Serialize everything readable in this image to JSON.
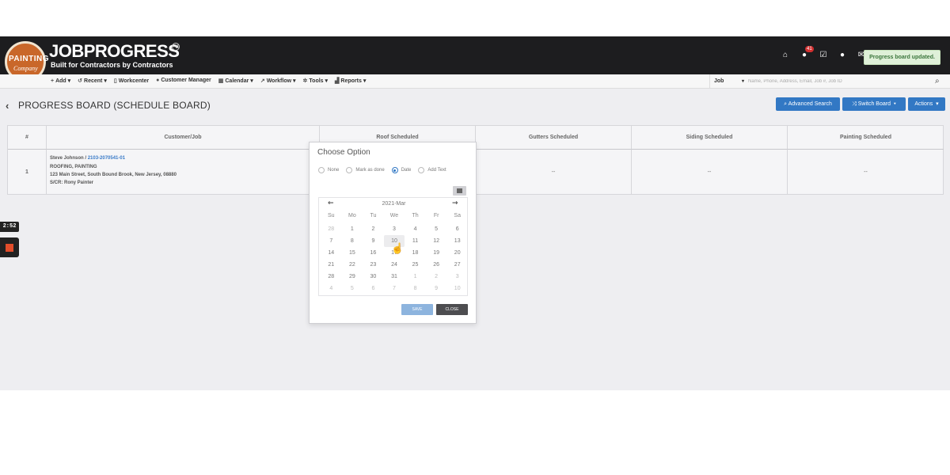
{
  "header": {
    "logo_text": "PAINTING",
    "logo_sub": "Company",
    "brand": "JOBPROGRESS",
    "trademark": "TM",
    "tagline": "Built for Contractors by Contractors",
    "notification_count": "41",
    "icons": [
      "home-icon",
      "bell-icon",
      "checkbox-icon",
      "chat-icon",
      "mail-icon"
    ],
    "toast": "Progress board updated."
  },
  "nav": {
    "items": [
      {
        "label": "Add",
        "icon": "plus-icon",
        "caret": true
      },
      {
        "label": "Recent",
        "icon": "history-icon",
        "caret": true
      },
      {
        "label": "Workcenter",
        "icon": "document-icon",
        "caret": false
      },
      {
        "label": "Customer Manager",
        "icon": "users-icon",
        "caret": false
      },
      {
        "label": "Calendar",
        "icon": "calendar-icon",
        "caret": true
      },
      {
        "label": "Workflow",
        "icon": "workflow-icon",
        "caret": true
      },
      {
        "label": "Tools",
        "icon": "gear-icon",
        "caret": true
      },
      {
        "label": "Reports",
        "icon": "chart-icon",
        "caret": true
      }
    ],
    "search_type": "Job",
    "search_placeholder": "Name, Phone, Address, Email, Job #, Job ID"
  },
  "page": {
    "title": "PROGRESS BOARD (SCHEDULE BOARD)",
    "buttons": {
      "advanced_search": "Advanced Search",
      "switch_board": "Switch Board",
      "actions": "Actions"
    }
  },
  "board": {
    "columns": [
      "#",
      "Customer/Job",
      "Roof Scheduled",
      "Gutters Scheduled",
      "Siding Scheduled",
      "Painting Scheduled"
    ],
    "rows": [
      {
        "index": "1",
        "customer": "Steve Johnson /",
        "job_number": "2103-2070541-01",
        "trades": "ROOFING, PAINTING",
        "address": "123 Main Street, South Bound Brook, New Jersey, 08880",
        "scr": "S/CR: Rony Painter",
        "gutters": "--",
        "siding": "--",
        "painting": "--"
      }
    ]
  },
  "recorder": {
    "timer": "2:52"
  },
  "popup": {
    "title": "Choose Option",
    "options": [
      {
        "label": "None",
        "selected": false
      },
      {
        "label": "Mark as done",
        "selected": false
      },
      {
        "label": "Date",
        "selected": true
      },
      {
        "label": "Add Text",
        "selected": false
      }
    ],
    "calendar": {
      "month_label": "2021-Mar",
      "weekdays": [
        "Su",
        "Mo",
        "Tu",
        "We",
        "Th",
        "Fr",
        "Sa"
      ],
      "days": [
        {
          "d": "28",
          "muted": true
        },
        {
          "d": "1"
        },
        {
          "d": "2"
        },
        {
          "d": "3"
        },
        {
          "d": "4"
        },
        {
          "d": "5"
        },
        {
          "d": "6"
        },
        {
          "d": "7"
        },
        {
          "d": "8"
        },
        {
          "d": "9"
        },
        {
          "d": "10",
          "selected": true
        },
        {
          "d": "11"
        },
        {
          "d": "12"
        },
        {
          "d": "13"
        },
        {
          "d": "14"
        },
        {
          "d": "15"
        },
        {
          "d": "16"
        },
        {
          "d": "17"
        },
        {
          "d": "18"
        },
        {
          "d": "19"
        },
        {
          "d": "20"
        },
        {
          "d": "21"
        },
        {
          "d": "22"
        },
        {
          "d": "23"
        },
        {
          "d": "24"
        },
        {
          "d": "25"
        },
        {
          "d": "26"
        },
        {
          "d": "27"
        },
        {
          "d": "28"
        },
        {
          "d": "29"
        },
        {
          "d": "30"
        },
        {
          "d": "31"
        },
        {
          "d": "1",
          "muted": true
        },
        {
          "d": "2",
          "muted": true
        },
        {
          "d": "3",
          "muted": true
        },
        {
          "d": "4",
          "muted": true
        },
        {
          "d": "5",
          "muted": true
        },
        {
          "d": "6",
          "muted": true
        },
        {
          "d": "7",
          "muted": true
        },
        {
          "d": "8",
          "muted": true
        },
        {
          "d": "9",
          "muted": true
        },
        {
          "d": "10",
          "muted": true
        }
      ]
    },
    "save_label": "SAVE",
    "close_label": "CLOSE"
  },
  "colors": {
    "primary": "#3278c4",
    "header_bg": "#1d1d1f",
    "toast_bg": "#dff0d8",
    "record": "#e24d2b"
  }
}
